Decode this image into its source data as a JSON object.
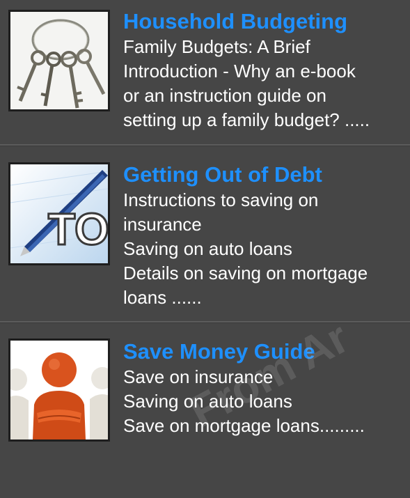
{
  "items": [
    {
      "title": "Household Budgeting",
      "lines": [
        "Family Budgets: A Brief",
        "Introduction - Why an e-book",
        "or an instruction guide on",
        "setting up a family budget? ....."
      ],
      "icon": "keys-icon"
    },
    {
      "title": "Getting Out of Debt",
      "lines": [
        "Instructions to saving on",
        "insurance",
        "Saving on auto loans",
        "Details on saving on mortgage",
        "loans ......"
      ],
      "icon": "todo-list-icon",
      "thumb_text": "TO"
    },
    {
      "title": "Save Money Guide",
      "lines": [
        "Save on insurance",
        "Saving on auto loans",
        "Save on mortgage loans........."
      ],
      "icon": "people-figures-icon"
    }
  ],
  "watermark": "From Ar",
  "colors": {
    "background": "#464646",
    "title": "#1e90ff",
    "text": "#ffffff"
  }
}
